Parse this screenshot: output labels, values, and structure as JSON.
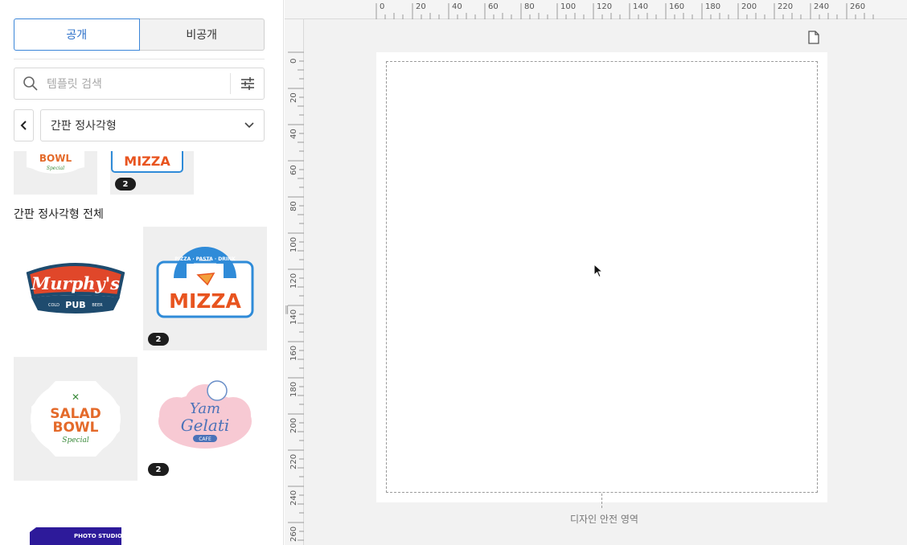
{
  "tabs": {
    "public": "공개",
    "private": "비공개"
  },
  "search": {
    "placeholder": "템플릿 검색"
  },
  "category": {
    "selected": "간판 정사각형"
  },
  "section": {
    "title": "간판 정사각형 전체"
  },
  "templates": [
    {
      "name": "Salad Bowl",
      "logo_lines": [
        "BOWL",
        "Special"
      ]
    },
    {
      "name": "Mizza",
      "logo_lines": [
        "MIZZA"
      ],
      "pages": "2"
    },
    {
      "name": "Murphy's",
      "logo_lines": [
        "Murphy's",
        "COLD",
        "PUB",
        "BEER"
      ]
    },
    {
      "name": "Mizza",
      "logo_lines": [
        "PIZZA · PASTA · DRINK",
        "MIZZA"
      ],
      "pages": "2"
    },
    {
      "name": "Salad Bowl",
      "logo_lines": [
        "SALAD",
        "BOWL",
        "Special"
      ]
    },
    {
      "name": "Yam Gelati",
      "logo_lines": [
        "Yam",
        "Gelati",
        "CAFE"
      ],
      "pages": "2"
    },
    {
      "name": "Photo Studio",
      "logo_lines": [
        "PHOTO STUDIO"
      ]
    }
  ],
  "ruler": {
    "top": [
      "0",
      "20",
      "40",
      "60",
      "80",
      "100",
      "120",
      "140",
      "160",
      "180",
      "200",
      "220",
      "240",
      "260"
    ],
    "left": [
      "0",
      "20",
      "40",
      "60",
      "80",
      "100",
      "120",
      "140",
      "160",
      "180",
      "200",
      "220",
      "240",
      "260"
    ]
  },
  "canvas": {
    "safe_area_label": "디자인 안전 영역"
  },
  "colors": {
    "accent": "#3b86d9",
    "orange": "#e8541f",
    "blue": "#2f8bd8"
  }
}
